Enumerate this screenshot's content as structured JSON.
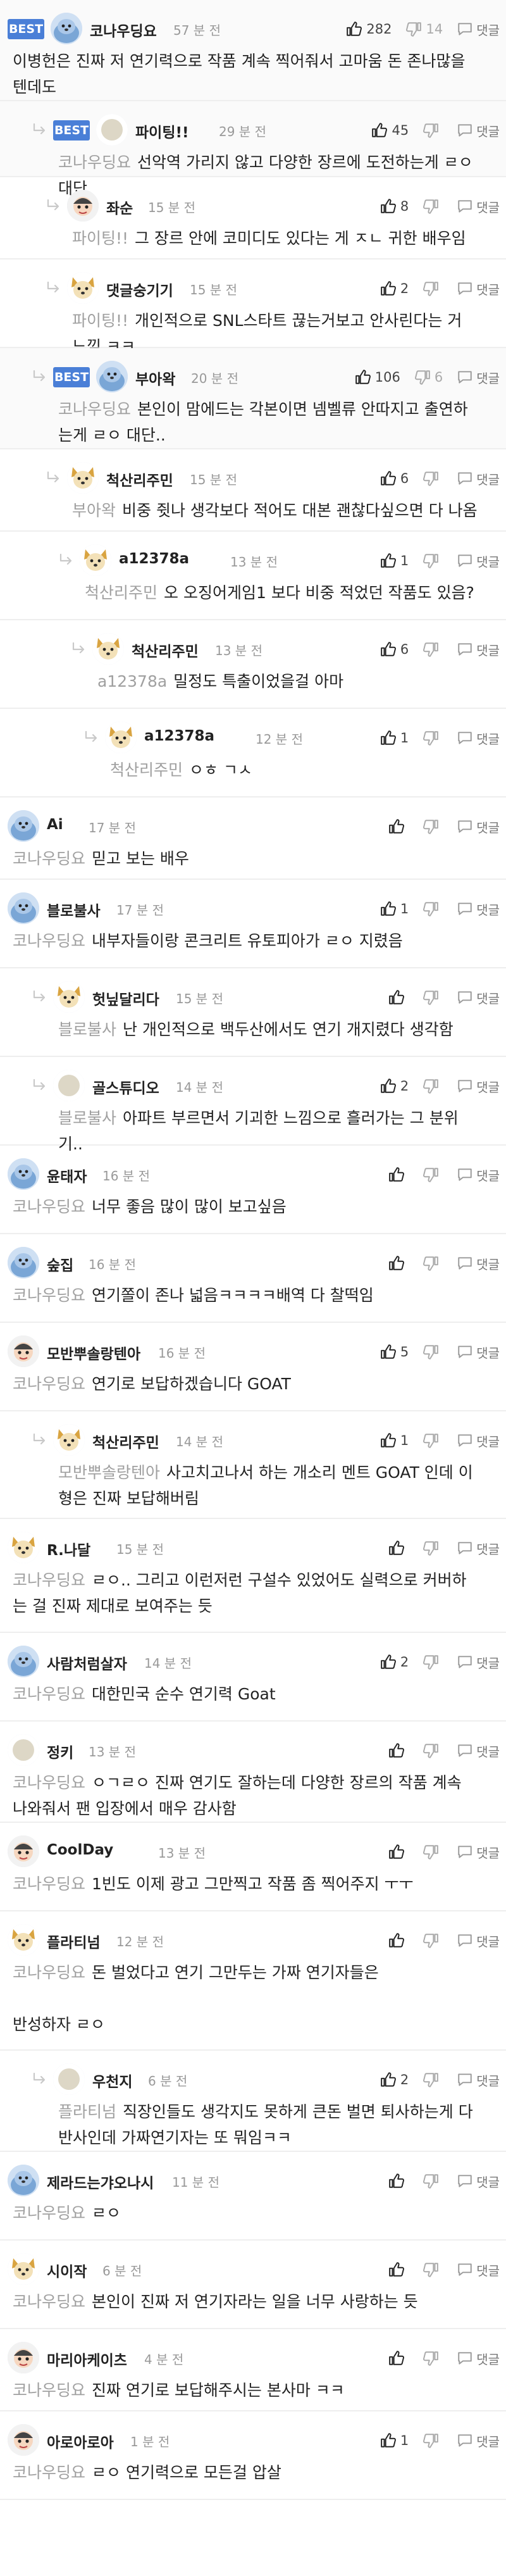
{
  "labels": {
    "best": "BEST",
    "reply": "댓글"
  },
  "colors": {
    "best_badge": "#4a7fd7",
    "mention_text": "#a0a0a0",
    "thumb_up": "#222222",
    "thumb_down": "#aaaaaa"
  },
  "comments": [
    {
      "nick": "코나우딩요",
      "time": "57 분 전",
      "avatar": "seal-avatar",
      "best": true,
      "likes": "282",
      "dislikes": "14",
      "text": "이병헌은 진짜 저 연기력으로 작품 계속 찍어줘서 고마움 돈 존나많을 텐데도"
    },
    {
      "nick": "파이팅!!",
      "time": "29 분 전",
      "avatar": "blank-avatar",
      "best": true,
      "likes": "45",
      "dislikes": "",
      "mention": "코나우딩요",
      "text": "선악역 가리지 않고 다양한 장르에 도전하는게 ㄹㅇ 대단"
    },
    {
      "nick": "좌순",
      "time": "15 분 전",
      "avatar": "cartoon-avatar",
      "likes": "8",
      "dislikes": "",
      "mention": "파이팅!!",
      "text": "그 장르 안에 코미디도 있다는 게 ㅈㄴ 귀한 배우임"
    },
    {
      "nick": "댓글숭기기",
      "time": "15 분 전",
      "avatar": "dog-avatar",
      "likes": "2",
      "dislikes": "",
      "mention": "파이팅!!",
      "text": "개인적으로 SNL스타트 끊는거보고 안사린다는 거 느낌 ㅋㅋ"
    },
    {
      "nick": "부아왁",
      "time": "20 분 전",
      "avatar": "seal-avatar",
      "best": true,
      "likes": "106",
      "dislikes": "6",
      "mention": "코나우딩요",
      "text": "본인이 맘에드는 각본이면 넴벨류 안따지고 출연하는게 ㄹㅇ 대단.."
    },
    {
      "nick": "척산리주민",
      "time": "15 분 전",
      "avatar": "dog-avatar",
      "likes": "6",
      "dislikes": "",
      "mention": "부아왁",
      "text": "비중 쥣나 생각보다 적어도 대본 괜찮다싶으면 다 나옴"
    },
    {
      "nick": "a12378a",
      "time": "13 분 전",
      "avatar": "dog-avatar",
      "likes": "1",
      "dislikes": "",
      "mention": "척산리주민",
      "text": "오 오징어게임1 보다 비중 적었던 작품도 있음?"
    },
    {
      "nick": "척산리주민",
      "time": "13 분 전",
      "avatar": "dog-avatar",
      "likes": "6",
      "dislikes": "",
      "mention": "a12378a",
      "text": "밀정도 특출이었을걸 아마"
    },
    {
      "nick": "a12378a",
      "time": "12 분 전",
      "avatar": "dog-avatar",
      "likes": "1",
      "dislikes": "",
      "mention": "척산리주민",
      "text": "ㅇㅎ ㄱㅅ"
    },
    {
      "nick": "Ai",
      "time": "17 분 전",
      "avatar": "seal-avatar",
      "likes": "",
      "dislikes": "",
      "mention": "코나우딩요",
      "text": "믿고 보는 배우"
    },
    {
      "nick": "블로불사",
      "time": "17 분 전",
      "avatar": "seal-avatar",
      "likes": "1",
      "dislikes": "",
      "mention": "코나우딩요",
      "text": "내부자들이랑 콘크리트 유토피아가 ㄹㅇ 지렸음"
    },
    {
      "nick": "헛닢달리다",
      "time": "15 분 전",
      "avatar": "dog-avatar",
      "likes": "",
      "dislikes": "",
      "mention": "블로불사",
      "text": "난 개인적으로 백두산에서도 연기 개지렸다 생각함"
    },
    {
      "nick": "골스튜디오",
      "time": "14 분 전",
      "avatar": "blank-avatar",
      "likes": "2",
      "dislikes": "",
      "mention": "블로불사",
      "text": "아파트 부르면서 기괴한 느낌으로 흘러가는 그 분위기.."
    },
    {
      "nick": "윤태자",
      "time": "16 분 전",
      "avatar": "seal-avatar",
      "likes": "",
      "dislikes": "",
      "mention": "코나우딩요",
      "text": "너무 좋음 많이 많이 보고싶음"
    },
    {
      "nick": "숲집",
      "time": "16 분 전",
      "avatar": "seal-avatar",
      "likes": "",
      "dislikes": "",
      "mention": "코나우딩요",
      "text": "연기쫄이 존나 넓음ㅋㅋㅋㅋ배역 다 찰떡임"
    },
    {
      "nick": "모반뿌솔랑텐아",
      "time": "16 분 전",
      "avatar": "cartoon-avatar",
      "likes": "5",
      "dislikes": "",
      "mention": "코나우딩요",
      "text": "연기로 보답하겠습니다 GOAT"
    },
    {
      "nick": "척산리주민",
      "time": "14 분 전",
      "avatar": "dog-avatar",
      "likes": "1",
      "dislikes": "",
      "mention": "모반뿌솔랑텐아",
      "text": "사고치고나서 하는 개소리 멘트 GOAT 인데 이 형은 진짜 보답해버림"
    },
    {
      "nick": "R.나달",
      "time": "15 분 전",
      "avatar": "dog-avatar",
      "likes": "",
      "dislikes": "",
      "mention": "코나우딩요",
      "text": "ㄹㅇ.. 그리고 이런저런 구설수 있었어도 실력으로 커버하는 걸 진짜 제대로 보여주는 듯"
    },
    {
      "nick": "사람처럼살자",
      "time": "14 분 전",
      "avatar": "seal-avatar",
      "likes": "2",
      "dislikes": "",
      "mention": "코나우딩요",
      "text": "대한민국 순수 연기력 Goat"
    },
    {
      "nick": "정키",
      "time": "13 분 전",
      "avatar": "blank-avatar",
      "likes": "",
      "dislikes": "",
      "mention": "코나우딩요",
      "text": "ㅇㄱㄹㅇ 진짜 연기도 잘하는데 다양한 장르의 작품 계속 나와줘서 팬 입장에서 매우 감사함"
    },
    {
      "nick": "CoolDay",
      "time": "13 분 전",
      "avatar": "cartoon-avatar",
      "likes": "",
      "dislikes": "",
      "mention": "코나우딩요",
      "text": "1빈도 이제 광고 그만찍고 작품 좀 찍어주지 ㅜㅜ"
    },
    {
      "nick": "플라티넘",
      "time": "12 분 전",
      "avatar": "dog-avatar",
      "likes": "",
      "dislikes": "",
      "mention": "코나우딩요",
      "text": "돈 벌었다고 연기 그만두는 가짜 연기자들은\n\n반성하자 ㄹㅇ"
    },
    {
      "nick": "우천지",
      "time": "6 분 전",
      "avatar": "blank-avatar",
      "likes": "2",
      "dislikes": "",
      "mention": "플라티넘",
      "text": "직장인들도 생각지도 못하게 큰돈 벌면 퇴사하는게 다반사인데 가짜연기자는 또 뭐임ㅋㅋ"
    },
    {
      "nick": "제라드는갸오나시",
      "time": "11 분 전",
      "avatar": "seal-avatar",
      "likes": "",
      "dislikes": "",
      "mention": "코나우딩요",
      "text": "ㄹㅇ"
    },
    {
      "nick": "시이작",
      "time": "6 분 전",
      "avatar": "dog-avatar",
      "likes": "",
      "dislikes": "",
      "mention": "코나우딩요",
      "text": "본인이 진짜 저 연기자라는 일을 너무 사랑하는 듯"
    },
    {
      "nick": "마리아케이츠",
      "time": "4 분 전",
      "avatar": "cartoon-avatar",
      "likes": "",
      "dislikes": "",
      "mention": "코나우딩요",
      "text": "진짜 연기로 보답해주시는 본사마 ㅋㅋ"
    },
    {
      "nick": "아로아로아",
      "time": "1 분 전",
      "avatar": "cartoon-avatar",
      "likes": "1",
      "dislikes": "",
      "mention": "코나우딩요",
      "text": "ㄹㅇ 연기력으로 모든걸 압살"
    }
  ]
}
